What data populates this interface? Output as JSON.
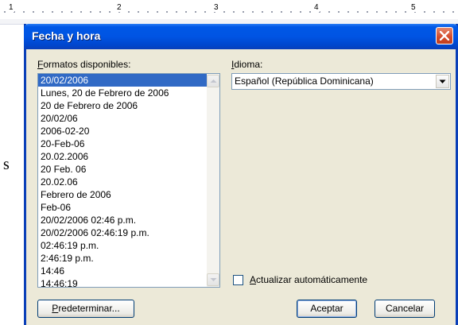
{
  "ruler": {
    "numbers": [
      "1",
      "2",
      "3",
      "4",
      "5"
    ]
  },
  "background": {
    "letter": "s"
  },
  "dialog": {
    "title": "Fecha y hora",
    "formats_label": "Formatos disponibles:",
    "formats_label_accel": "F",
    "formats_label_rest": "ormatos disponibles:",
    "language_label_accel": "I",
    "language_label_rest": "dioma:",
    "formats": [
      "20/02/2006",
      "Lunes, 20 de Febrero de 2006",
      "20 de Febrero de 2006",
      "20/02/06",
      "2006-02-20",
      "20-Feb-06",
      "20.02.2006",
      "20 Feb. 06",
      "20.02.06",
      "Febrero de 2006",
      "Feb-06",
      "20/02/2006 02:46 p.m.",
      "20/02/2006 02:46:19 p.m.",
      "02:46:19 p.m.",
      "2:46:19 p.m.",
      "14:46",
      "14:46:19"
    ],
    "selected_format": "20/02/2006",
    "language_value": "Español (República Dominicana)",
    "auto_update_accel": "A",
    "auto_update_rest": "ctualizar automáticamente",
    "auto_update_checked": false,
    "default_button_accel": "P",
    "default_button_rest": "redeterminar...",
    "ok_button": "Aceptar",
    "cancel_button": "Cancelar"
  },
  "colors": {
    "titlebar": "#0054e3",
    "selection": "#316ac5",
    "dialog_bg": "#ece9d8"
  }
}
